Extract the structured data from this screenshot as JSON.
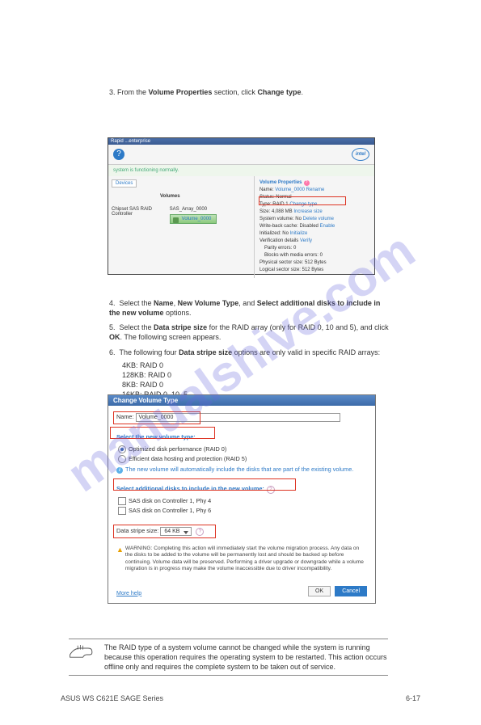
{
  "watermark": "manualshive.com",
  "instr3": {
    "num": "3.",
    "text_a": "From the ",
    "bold": "Volume Properties",
    "text_b": " section, click ",
    "bold2": "Change type"
  },
  "screenshot": {
    "titlebar": "Rapid ...enterprise",
    "status": "system is functioning normally.",
    "devices_tab": "Devices",
    "volumes_label": "Volumes",
    "controller": "Chipset SAS RAID Controller",
    "array": "SAS_Array_0000",
    "volume": "Volume_0000",
    "intel": "intel",
    "props": {
      "heading": "Volume Properties",
      "name_k": "Name:",
      "name_v": "Volume_0000",
      "rename": "Rename",
      "status_k": "Status:",
      "status_v": "Normal",
      "type_k": "Type:",
      "type_v": "RAID 1",
      "change": "Change type",
      "size_k": "Size:",
      "size_v": "4,088 MB",
      "incsize": "Increase size",
      "sysvol_k": "System volume:",
      "sysvol_v": "No",
      "delvol": "Delete volume",
      "wbc_k": "Write-back cache:",
      "wbc_v": "Disabled",
      "enable": "Enable",
      "init_k": "Initialized:",
      "init_v": "No",
      "init_link": "Initialize",
      "verif_k": "Verification details",
      "verify": "Verify",
      "parity": "Parity errors: 0",
      "blocks": "Blocks with media errors: 0",
      "phys": "Physical sector size: 512 Bytes",
      "log": "Logical sector size: 512 Bytes"
    }
  },
  "instr4_6": {
    "i4": "Select the ",
    "i4b": "Name",
    "i4c": ", ",
    "i4d": "New Volume Type",
    "i4e": ", and ",
    "i4f": "Select additional disks to include in the new volume",
    "i4g": " options.",
    "i5": "Select the ",
    "i5b": "Data stripe size",
    "i5c": " for the RAID array (only for RAID 0, 10 and 5), and click ",
    "i5d": "OK",
    "i5e": ". The following screen appears.",
    "i6a": "The following four ",
    "i6b": "Data stripe size",
    "i6c": " options are only valid in specific RAID arrays:"
  },
  "dialog": {
    "title": "Change Volume Type",
    "name_label": "Name:",
    "name_value": "Volume_0000",
    "sect1": "Select the new volume type:",
    "opt1": "Optimized disk performance (RAID 0)",
    "opt2": "Efficient data hosting and protection (RAID 5)",
    "autotext": "The new volume will automatically include the disks that are part of the existing volume.",
    "sect2": "Select additional disks to include in the new volume:",
    "disk1": "SAS disk on Controller 1, Phy 4",
    "disk2": "SAS disk on Controller 1, Phy 6",
    "stripe_label": "Data stripe size:",
    "stripe_value": "64 KB",
    "warning": "WARNING: Completing this action will immediately start the volume migration process. Any data on the disks to be added to the volume will be permanently lost and should be backed up before continuing. Volume data will be preserved. Performing a driver upgrade or downgrade while a volume migration is in progress may make the volume inaccessible due to driver incompatibility.",
    "more_help": "More help",
    "ok": "OK",
    "cancel": "Cancel"
  },
  "note": {
    "text": "The RAID type of a system volume cannot be changed while the system is running because this operation requires the operating system to be restarted. This action occurs offline only and requires the complete system to be taken out of service."
  },
  "footer": {
    "left": "ASUS WS C621E SAGE Series",
    "right": "6-17"
  }
}
